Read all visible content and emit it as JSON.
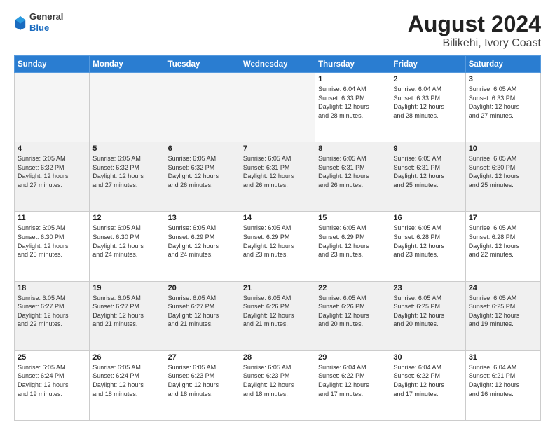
{
  "header": {
    "logo_line1": "General",
    "logo_line2": "Blue",
    "title": "August 2024",
    "subtitle": "Bilikehi, Ivory Coast"
  },
  "days_of_week": [
    "Sunday",
    "Monday",
    "Tuesday",
    "Wednesday",
    "Thursday",
    "Friday",
    "Saturday"
  ],
  "weeks": [
    [
      {
        "day": "",
        "info": "",
        "empty": true
      },
      {
        "day": "",
        "info": "",
        "empty": true
      },
      {
        "day": "",
        "info": "",
        "empty": true
      },
      {
        "day": "",
        "info": "",
        "empty": true
      },
      {
        "day": "1",
        "info": "Sunrise: 6:04 AM\nSunset: 6:33 PM\nDaylight: 12 hours\nand 28 minutes.",
        "empty": false
      },
      {
        "day": "2",
        "info": "Sunrise: 6:04 AM\nSunset: 6:33 PM\nDaylight: 12 hours\nand 28 minutes.",
        "empty": false
      },
      {
        "day": "3",
        "info": "Sunrise: 6:05 AM\nSunset: 6:33 PM\nDaylight: 12 hours\nand 27 minutes.",
        "empty": false
      }
    ],
    [
      {
        "day": "4",
        "info": "Sunrise: 6:05 AM\nSunset: 6:32 PM\nDaylight: 12 hours\nand 27 minutes.",
        "empty": false
      },
      {
        "day": "5",
        "info": "Sunrise: 6:05 AM\nSunset: 6:32 PM\nDaylight: 12 hours\nand 27 minutes.",
        "empty": false
      },
      {
        "day": "6",
        "info": "Sunrise: 6:05 AM\nSunset: 6:32 PM\nDaylight: 12 hours\nand 26 minutes.",
        "empty": false
      },
      {
        "day": "7",
        "info": "Sunrise: 6:05 AM\nSunset: 6:31 PM\nDaylight: 12 hours\nand 26 minutes.",
        "empty": false
      },
      {
        "day": "8",
        "info": "Sunrise: 6:05 AM\nSunset: 6:31 PM\nDaylight: 12 hours\nand 26 minutes.",
        "empty": false
      },
      {
        "day": "9",
        "info": "Sunrise: 6:05 AM\nSunset: 6:31 PM\nDaylight: 12 hours\nand 25 minutes.",
        "empty": false
      },
      {
        "day": "10",
        "info": "Sunrise: 6:05 AM\nSunset: 6:30 PM\nDaylight: 12 hours\nand 25 minutes.",
        "empty": false
      }
    ],
    [
      {
        "day": "11",
        "info": "Sunrise: 6:05 AM\nSunset: 6:30 PM\nDaylight: 12 hours\nand 25 minutes.",
        "empty": false
      },
      {
        "day": "12",
        "info": "Sunrise: 6:05 AM\nSunset: 6:30 PM\nDaylight: 12 hours\nand 24 minutes.",
        "empty": false
      },
      {
        "day": "13",
        "info": "Sunrise: 6:05 AM\nSunset: 6:29 PM\nDaylight: 12 hours\nand 24 minutes.",
        "empty": false
      },
      {
        "day": "14",
        "info": "Sunrise: 6:05 AM\nSunset: 6:29 PM\nDaylight: 12 hours\nand 23 minutes.",
        "empty": false
      },
      {
        "day": "15",
        "info": "Sunrise: 6:05 AM\nSunset: 6:29 PM\nDaylight: 12 hours\nand 23 minutes.",
        "empty": false
      },
      {
        "day": "16",
        "info": "Sunrise: 6:05 AM\nSunset: 6:28 PM\nDaylight: 12 hours\nand 23 minutes.",
        "empty": false
      },
      {
        "day": "17",
        "info": "Sunrise: 6:05 AM\nSunset: 6:28 PM\nDaylight: 12 hours\nand 22 minutes.",
        "empty": false
      }
    ],
    [
      {
        "day": "18",
        "info": "Sunrise: 6:05 AM\nSunset: 6:27 PM\nDaylight: 12 hours\nand 22 minutes.",
        "empty": false
      },
      {
        "day": "19",
        "info": "Sunrise: 6:05 AM\nSunset: 6:27 PM\nDaylight: 12 hours\nand 21 minutes.",
        "empty": false
      },
      {
        "day": "20",
        "info": "Sunrise: 6:05 AM\nSunset: 6:27 PM\nDaylight: 12 hours\nand 21 minutes.",
        "empty": false
      },
      {
        "day": "21",
        "info": "Sunrise: 6:05 AM\nSunset: 6:26 PM\nDaylight: 12 hours\nand 21 minutes.",
        "empty": false
      },
      {
        "day": "22",
        "info": "Sunrise: 6:05 AM\nSunset: 6:26 PM\nDaylight: 12 hours\nand 20 minutes.",
        "empty": false
      },
      {
        "day": "23",
        "info": "Sunrise: 6:05 AM\nSunset: 6:25 PM\nDaylight: 12 hours\nand 20 minutes.",
        "empty": false
      },
      {
        "day": "24",
        "info": "Sunrise: 6:05 AM\nSunset: 6:25 PM\nDaylight: 12 hours\nand 19 minutes.",
        "empty": false
      }
    ],
    [
      {
        "day": "25",
        "info": "Sunrise: 6:05 AM\nSunset: 6:24 PM\nDaylight: 12 hours\nand 19 minutes.",
        "empty": false
      },
      {
        "day": "26",
        "info": "Sunrise: 6:05 AM\nSunset: 6:24 PM\nDaylight: 12 hours\nand 18 minutes.",
        "empty": false
      },
      {
        "day": "27",
        "info": "Sunrise: 6:05 AM\nSunset: 6:23 PM\nDaylight: 12 hours\nand 18 minutes.",
        "empty": false
      },
      {
        "day": "28",
        "info": "Sunrise: 6:05 AM\nSunset: 6:23 PM\nDaylight: 12 hours\nand 18 minutes.",
        "empty": false
      },
      {
        "day": "29",
        "info": "Sunrise: 6:04 AM\nSunset: 6:22 PM\nDaylight: 12 hours\nand 17 minutes.",
        "empty": false
      },
      {
        "day": "30",
        "info": "Sunrise: 6:04 AM\nSunset: 6:22 PM\nDaylight: 12 hours\nand 17 minutes.",
        "empty": false
      },
      {
        "day": "31",
        "info": "Sunrise: 6:04 AM\nSunset: 6:21 PM\nDaylight: 12 hours\nand 16 minutes.",
        "empty": false
      }
    ]
  ]
}
